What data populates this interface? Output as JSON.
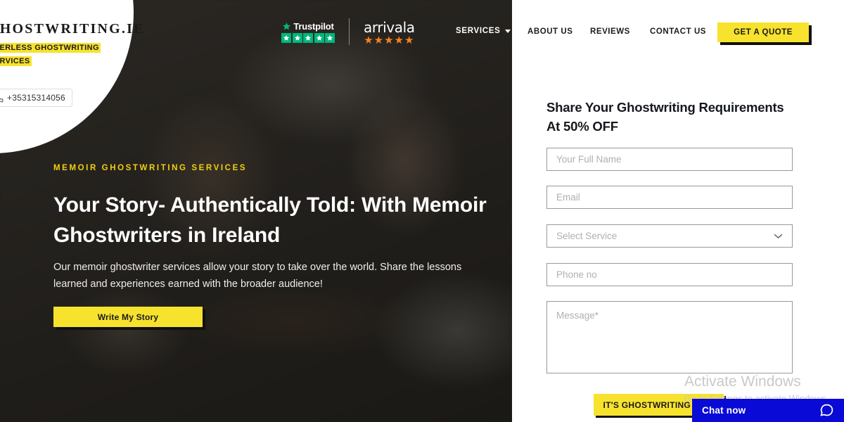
{
  "brand": {
    "logo_title": "GHOSTWRITING.IE",
    "logo_tagline": "PEERLESS GHOSTWRITING SERVICES",
    "phone": "+35315314056",
    "accent_yellow": "#F7E22E",
    "hero_dark": "#2E2C29",
    "chat_blue": "#0A0AD6"
  },
  "badges": {
    "trustpilot_name": "Trustpilot",
    "trustpilot_stars": 5,
    "trustpilot_color": "#00B67A",
    "arrivala_name": "arrivala",
    "arrivala_stars": "★★★★★",
    "arrivala_color": "#F58220"
  },
  "nav": {
    "services": "SERVICES",
    "about": "ABOUT US",
    "reviews": "REVIEWS",
    "contact": "CONTACT US",
    "quote_button": "GET A QUOTE"
  },
  "hero": {
    "eyebrow": "MEMOIR GHOSTWRITING SERVICES",
    "headline": "Your Story- Authentically Told: With Memoir Ghostwriters in Ireland",
    "paragraph": "Our memoir ghostwriter services allow your story to take over the world. Share the lessons learned and experiences earned with the broader audience!",
    "cta": "Write My Story"
  },
  "form": {
    "title": "Share Your Ghostwriting Requirements At 50% OFF",
    "full_name_placeholder": "Your Full Name",
    "email_placeholder": "Email",
    "service_selected": "Select Service",
    "phone_placeholder": "Phone no",
    "message_placeholder": "Message*",
    "submit_label": "IT'S GHOSTWRITING TIME"
  },
  "watermark": {
    "line1": "Activate Windows",
    "line2": "Go to Settings to activate Windows."
  },
  "chat": {
    "label": "Chat now"
  }
}
